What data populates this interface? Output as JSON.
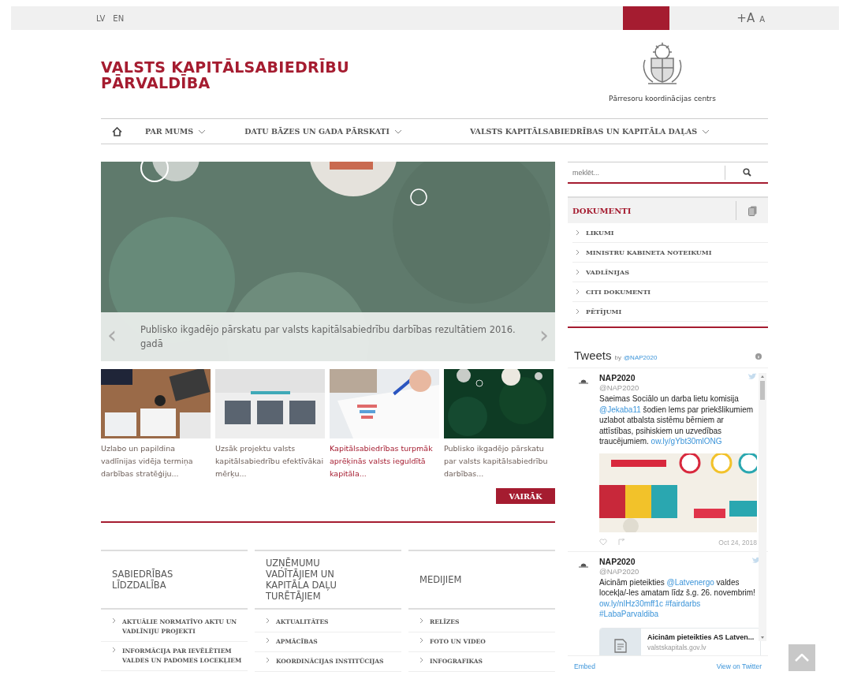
{
  "top_bar": {
    "languages": [
      "LV",
      "EN"
    ],
    "font_size_controls": [
      "+A",
      "A"
    ]
  },
  "header": {
    "title": "VALSTS KAPITĀLSABIEDRĪBU PĀRVALDĪBA",
    "emblem_caption": "Pārresoru koordinācijas centrs"
  },
  "nav": {
    "items": [
      "PAR MUMS",
      "DATU BĀZES UN GADA PĀRSKATI",
      "VALSTS KAPITĀLSABIEDRĪBAS UN KAPITĀLA DAĻAS"
    ]
  },
  "slider": {
    "caption": "Publisko ikgadējo pārskatu par valsts kapitālsabiedrību darbības rezultātiem 2016. gadā",
    "prev": "‹",
    "next": "›"
  },
  "news": [
    {
      "title": "Uzlabo un papildina vadlīnijas vidēja termiņa darbības stratēģiju...",
      "highlighted": false
    },
    {
      "title": "Uzsāk projektu valsts kapitālsabiedrību efektīvākai mērķu...",
      "highlighted": false
    },
    {
      "title": "Kapitālsabiedrības turpmāk aprēķinās valsts ieguldītā kapitāla...",
      "highlighted": true
    },
    {
      "title": "Publisko ikgadējo pārskatu par valsts kapitālsabiedrību darbības...",
      "highlighted": false
    }
  ],
  "more_button": "VAIRĀK",
  "search": {
    "placeholder": "meklēt..."
  },
  "documents": {
    "title": "DOKUMENTI",
    "items": [
      "LIKUMI",
      "MINISTRU KABINETA NOTEIKUMI",
      "VADLĪNIJAS",
      "CITI DOKUMENTI",
      "PĒTĪJUMI"
    ]
  },
  "tweets": {
    "title": "Tweets",
    "by": "by",
    "handle": "@NAP2020",
    "items": [
      {
        "name": "NAP2020",
        "handle": "@NAP2020",
        "parts": [
          {
            "text": "Saeimas Sociālo un darba lietu komisija ",
            "link": false
          },
          {
            "text": "@Jekaba11",
            "link": true
          },
          {
            "text": " šodien lems par priekšlikumiem uzlabot atbalsta sistēmu bērniem ar attīstības, psihiskiem un uzvedības traucējumiem. ",
            "link": false
          },
          {
            "text": "ow.ly/gYbt30mlONG",
            "link": true
          }
        ],
        "media": {
          "kind": "picture"
        },
        "date": "Oct 24, 2018"
      },
      {
        "name": "NAP2020",
        "handle": "@NAP2020",
        "parts": [
          {
            "text": "Aicinām pieteikties ",
            "link": false
          },
          {
            "text": "@Latvenergo",
            "link": true
          },
          {
            "text": " valdes locekļa/-les amatam līdz š.g. 26. novembrim! ",
            "link": false
          },
          {
            "text": "ow.ly/nIHz30mff1c",
            "link": true
          },
          {
            "text": "#fairdarbs",
            "link": true
          },
          {
            "text": "#LabaParvaldiba",
            "link": true
          }
        ],
        "media": {
          "kind": "card",
          "title": "Aicinām pieteikties AS Latven...",
          "domain": "valstskapitals.gov.lv"
        }
      }
    ],
    "embed": "Embed",
    "view": "View on Twitter"
  },
  "footer_columns": [
    {
      "title": "SABIEDRĪBAS LĪDZDALĪBA",
      "items": [
        "AKTUĀLIE NORMATĪVO AKTU UN VADLĪNIJU PROJEKTI",
        "INFORMĀCIJA PAR IEVĒLĒTIEM VALDES UN PADOMES LOCEKĻIEM"
      ]
    },
    {
      "title": "UZŅĒMUMU VADĪTĀJIEM UN KAPITĀLA DAĻU TURĒTĀJIEM",
      "items": [
        "AKTUALITĀTES",
        "APMĀCĪBAS",
        "KOORDINĀCIJAS INSTITŪCIJAS"
      ]
    },
    {
      "title": "MEDIJIEM",
      "items": [
        "RELĪZES",
        "FOTO UN VIDEO",
        "INFOGRAFIKAS"
      ]
    }
  ]
}
